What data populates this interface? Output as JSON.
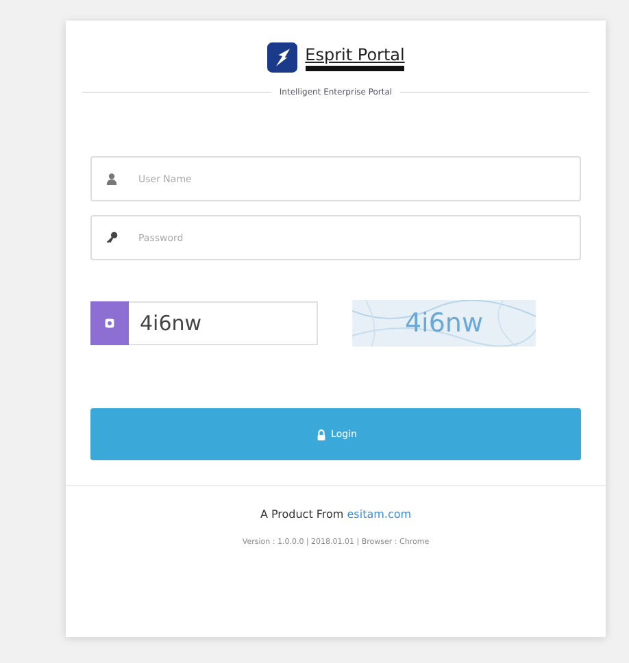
{
  "logo": {
    "title": "Esprit Portal"
  },
  "tagline": "Intelligent Enterprise Portal",
  "fields": [
    {
      "kind": "user",
      "placeholder": "User Name"
    },
    {
      "kind": "password",
      "placeholder": "Password"
    }
  ],
  "captcha": {
    "value": "4i6nw",
    "image_text": "4i6nw"
  },
  "login_button": "Login",
  "footer": {
    "prefix": "A Product From",
    "link": "esitam.com",
    "version": "Version : 1.0.0.0 | 2018.01.01 | Browser : Chrome"
  }
}
